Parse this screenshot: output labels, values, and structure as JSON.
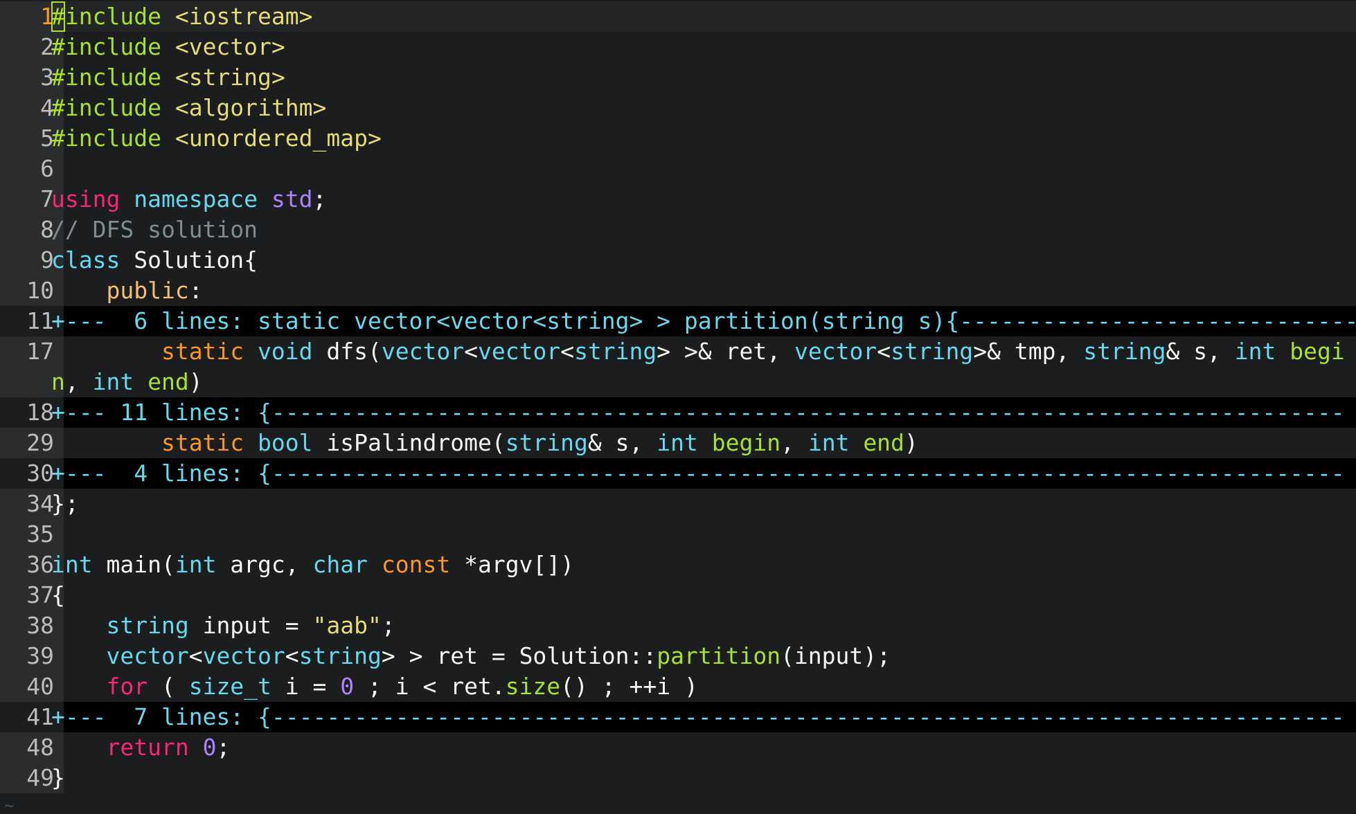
{
  "editor": {
    "lines": [
      {
        "num": "1",
        "tokens": [
          [
            "pre",
            "#include"
          ],
          [
            "def",
            " "
          ],
          [
            "inc",
            "<iostream>"
          ]
        ],
        "cursor": true
      },
      {
        "num": "2",
        "tokens": [
          [
            "pre",
            "#include"
          ],
          [
            "def",
            " "
          ],
          [
            "inc",
            "<vector>"
          ]
        ]
      },
      {
        "num": "3",
        "tokens": [
          [
            "pre",
            "#include"
          ],
          [
            "def",
            " "
          ],
          [
            "inc",
            "<string>"
          ]
        ]
      },
      {
        "num": "4",
        "tokens": [
          [
            "pre",
            "#include"
          ],
          [
            "def",
            " "
          ],
          [
            "inc",
            "<algorithm>"
          ]
        ]
      },
      {
        "num": "5",
        "tokens": [
          [
            "pre",
            "#include"
          ],
          [
            "def",
            " "
          ],
          [
            "inc",
            "<unordered_map>"
          ]
        ]
      },
      {
        "num": "6",
        "tokens": []
      },
      {
        "num": "7",
        "tokens": [
          [
            "kw",
            "using"
          ],
          [
            "def",
            " "
          ],
          [
            "type",
            "namespace"
          ],
          [
            "def",
            " "
          ],
          [
            "ns",
            "std"
          ],
          [
            "def",
            ";"
          ]
        ]
      },
      {
        "num": "8",
        "tokens": [
          [
            "cm",
            "// DFS solution"
          ]
        ]
      },
      {
        "num": "9",
        "tokens": [
          [
            "type",
            "class"
          ],
          [
            "def",
            " Solution{"
          ]
        ]
      },
      {
        "num": "10",
        "tokens": [
          [
            "def",
            "    "
          ],
          [
            "acc",
            "public"
          ],
          [
            "def",
            ":"
          ]
        ]
      },
      {
        "num": "11",
        "fold": true,
        "tokens": [
          [
            "fold",
            "+---  6 lines: static vector<vector<string> > partition(string s){-----------------------------"
          ]
        ]
      },
      {
        "num": "17",
        "tokens": [
          [
            "def",
            "        "
          ],
          [
            "sc",
            "static"
          ],
          [
            "def",
            " "
          ],
          [
            "type",
            "void"
          ],
          [
            "def",
            " dfs("
          ],
          [
            "type",
            "vector"
          ],
          [
            "def",
            "<"
          ],
          [
            "type",
            "vector"
          ],
          [
            "def",
            "<"
          ],
          [
            "type",
            "string"
          ],
          [
            "def",
            "> >& ret, "
          ],
          [
            "type",
            "vector"
          ],
          [
            "def",
            "<"
          ],
          [
            "type",
            "string"
          ],
          [
            "def",
            ">& tmp, "
          ],
          [
            "type",
            "string"
          ],
          [
            "def",
            "& s, "
          ],
          [
            "type",
            "int"
          ],
          [
            "def",
            " "
          ],
          [
            "fn",
            "begi"
          ]
        ]
      },
      {
        "num": "",
        "tokens": [
          [
            "fn",
            "n"
          ],
          [
            "def",
            ", "
          ],
          [
            "type",
            "int"
          ],
          [
            "def",
            " "
          ],
          [
            "fn",
            "end"
          ],
          [
            "def",
            ")"
          ]
        ]
      },
      {
        "num": "18",
        "fold": true,
        "tokens": [
          [
            "fold",
            "+--- 11 lines: {------------------------------------------------------------------------------"
          ]
        ]
      },
      {
        "num": "29",
        "tokens": [
          [
            "def",
            "        "
          ],
          [
            "sc",
            "static"
          ],
          [
            "def",
            " "
          ],
          [
            "type",
            "bool"
          ],
          [
            "def",
            " isPalindrome("
          ],
          [
            "type",
            "string"
          ],
          [
            "def",
            "& s, "
          ],
          [
            "type",
            "int"
          ],
          [
            "def",
            " "
          ],
          [
            "fn",
            "begin"
          ],
          [
            "def",
            ", "
          ],
          [
            "type",
            "int"
          ],
          [
            "def",
            " "
          ],
          [
            "fn",
            "end"
          ],
          [
            "def",
            ")"
          ]
        ]
      },
      {
        "num": "30",
        "fold": true,
        "tokens": [
          [
            "fold",
            "+---  4 lines: {------------------------------------------------------------------------------"
          ]
        ]
      },
      {
        "num": "34",
        "tokens": [
          [
            "def",
            "};"
          ]
        ]
      },
      {
        "num": "35",
        "tokens": []
      },
      {
        "num": "36",
        "tokens": [
          [
            "type",
            "int"
          ],
          [
            "def",
            " main("
          ],
          [
            "type",
            "int"
          ],
          [
            "def",
            " argc, "
          ],
          [
            "type",
            "char"
          ],
          [
            "def",
            " "
          ],
          [
            "sc",
            "const"
          ],
          [
            "def",
            " *argv[])"
          ]
        ]
      },
      {
        "num": "37",
        "tokens": [
          [
            "def",
            "{"
          ]
        ]
      },
      {
        "num": "38",
        "tokens": [
          [
            "def",
            "    "
          ],
          [
            "type",
            "string"
          ],
          [
            "def",
            " input = "
          ],
          [
            "str",
            "\"aab\""
          ],
          [
            "def",
            ";"
          ]
        ]
      },
      {
        "num": "39",
        "tokens": [
          [
            "def",
            "    "
          ],
          [
            "type",
            "vector"
          ],
          [
            "def",
            "<"
          ],
          [
            "type",
            "vector"
          ],
          [
            "def",
            "<"
          ],
          [
            "type",
            "string"
          ],
          [
            "def",
            "> > ret = Solution::"
          ],
          [
            "fn",
            "partition"
          ],
          [
            "def",
            "(input);"
          ]
        ]
      },
      {
        "num": "40",
        "tokens": [
          [
            "def",
            "    "
          ],
          [
            "kw",
            "for"
          ],
          [
            "def",
            " ( "
          ],
          [
            "type",
            "size_t"
          ],
          [
            "def",
            " i = "
          ],
          [
            "num",
            "0"
          ],
          [
            "def",
            " ; i < ret."
          ],
          [
            "fn",
            "size"
          ],
          [
            "def",
            "() ; ++i )"
          ]
        ]
      },
      {
        "num": "41",
        "fold": true,
        "tokens": [
          [
            "fold",
            "+---  7 lines: {------------------------------------------------------------------------------"
          ]
        ]
      },
      {
        "num": "48",
        "tokens": [
          [
            "def",
            "    "
          ],
          [
            "kw",
            "return"
          ],
          [
            "def",
            " "
          ],
          [
            "num",
            "0"
          ],
          [
            "def",
            ";"
          ]
        ]
      },
      {
        "num": "49",
        "tokens": [
          [
            "def",
            "}"
          ]
        ]
      }
    ],
    "end_marker": "~"
  },
  "colors": {
    "background": "#1b1d1e",
    "gutter": "#2a2c2d",
    "fold_background": "#000000",
    "keyword": "#f92672",
    "type": "#66d9ef",
    "function": "#a6e22e",
    "string": "#e6db74",
    "number": "#ae81ff",
    "comment": "#7e8e91"
  }
}
